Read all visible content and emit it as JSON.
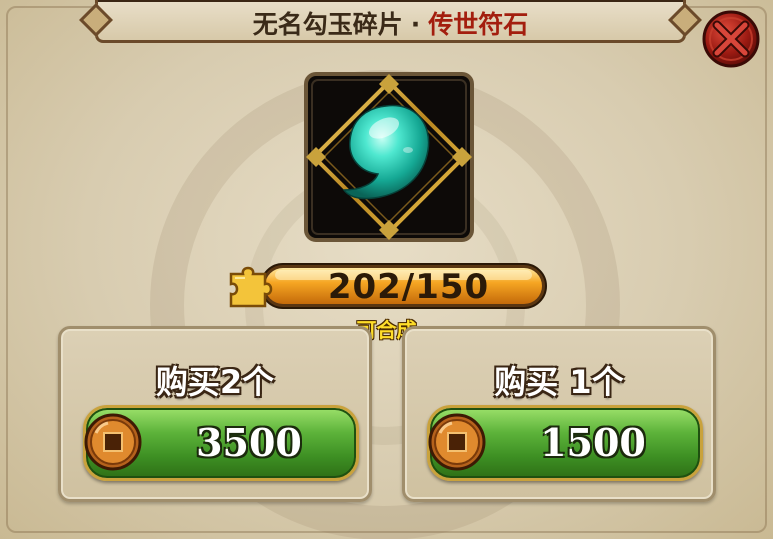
{
  "title": {
    "item_name": "无名勾玉碎片",
    "separator": "·",
    "item_type": "传世符石"
  },
  "item": {
    "icon": "jade-magatama-icon"
  },
  "progress": {
    "text": "202/150",
    "current": 202,
    "required": 150,
    "status": "可合成",
    "icon": "puzzle-piece-icon"
  },
  "options": [
    {
      "label": "购买2个",
      "price": "3500",
      "currency_icon": "copper-coin-icon"
    },
    {
      "label": "购买 1个",
      "price": "1500",
      "currency_icon": "copper-coin-icon"
    }
  ],
  "colors": {
    "title_sub": "#a31e0e",
    "status": "#ffde2a",
    "button_green": "#4ea52c",
    "jade": "#27c9b0"
  }
}
